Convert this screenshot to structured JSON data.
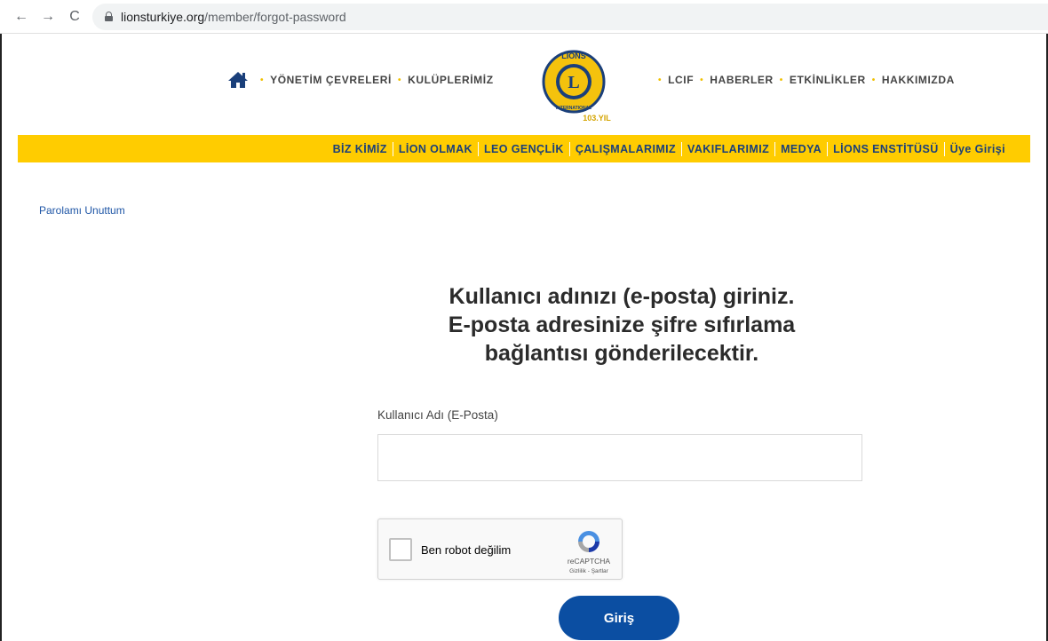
{
  "browser": {
    "url_domain": "lionsturkiye.org",
    "url_path": "/member/forgot-password",
    "back_icon": "arrow-left-icon",
    "forward_icon": "arrow-right-icon",
    "reload_icon": "reload-icon"
  },
  "topnav": {
    "left_items": [
      "YÖNETİM ÇEVRELERİ",
      "KULÜPLERİMİZ"
    ],
    "right_items": [
      "LCIF",
      "HABERLER",
      "ETKİNLİKLER",
      "HAKKIMIZDA"
    ],
    "separator": "•",
    "logo_text": "LIONS",
    "logo_sub": "INTERNATIONAL",
    "logo_badge": "103.YIL"
  },
  "yellow_menu": [
    "BİZ KİMİZ",
    "LİON OLMAK",
    "LEO GENÇLİK",
    "ÇALIŞMALARIMIZ",
    "VAKIFLARIMIZ",
    "MEDYA",
    "LİONS ENSTİTÜSÜ",
    "Üye Girişi"
  ],
  "breadcrumb": "Parolamı Unuttum",
  "heading": {
    "line1": "Kullanıcı adınızı (e-posta) giriniz.",
    "line2": "E-posta adresinize şifre sıfırlama",
    "line3": "bağlantısı gönderilecektir."
  },
  "form": {
    "email_label": "Kullanıcı Adı (E-Posta)",
    "email_value": "",
    "submit_label": "Giriş"
  },
  "recaptcha": {
    "label": "Ben robot değilim",
    "brand": "reCAPTCHA",
    "links": "Gizlilik - Şartlar"
  },
  "colors": {
    "yellow": "#ffcc00",
    "navy": "#1a3f7a",
    "button_blue": "#0b4ea2",
    "link_blue": "#1f56a6"
  }
}
